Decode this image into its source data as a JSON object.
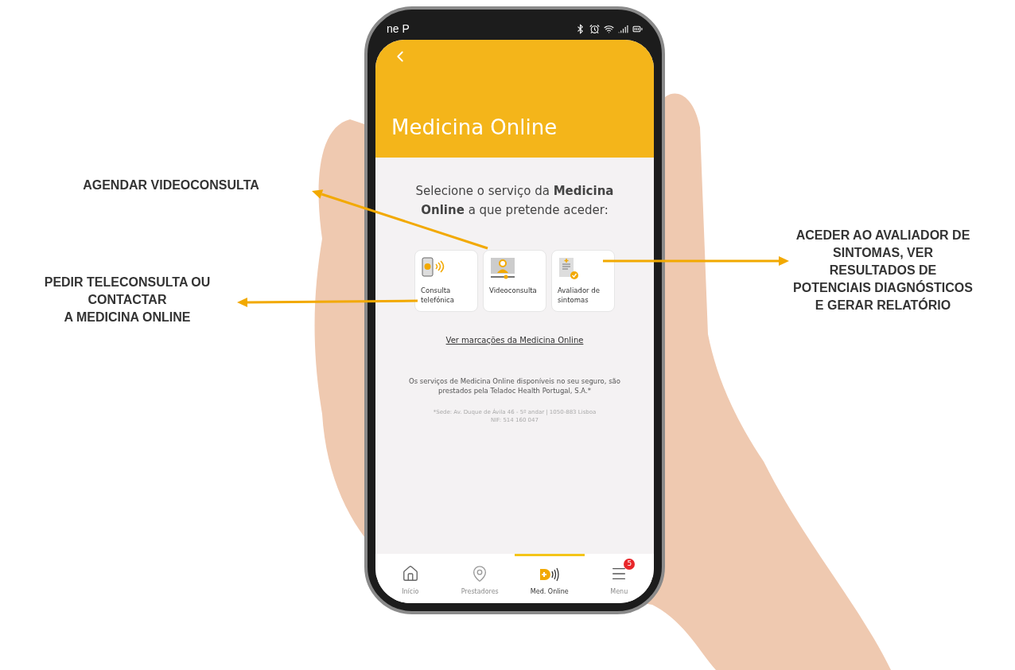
{
  "annotations": [
    {
      "text": "AGENDAR VIDEOCONSULTA"
    },
    {
      "text": "PEDIR TELECONSULTA OU\nCONTACTAR\nA MEDICINA ONLINE"
    },
    {
      "text": "ACEDER AO AVALIADOR DE\nSINTOMAS, VER\nRESULTADOS DE\nPOTENCIAIS DIAGNÓSTICOS\nE GERAR RELATÓRIO"
    }
  ],
  "phone": {
    "status_bar": {
      "carrier": "ne P"
    },
    "header": {
      "title": "Medicina Online"
    },
    "prompt": "Selecione o serviço da **Medicina Online** a que pretende aceder:",
    "services": [
      {
        "kind": "phone",
        "label": "Consulta telefónica"
      },
      {
        "kind": "video",
        "label": "Videoconsulta"
      },
      {
        "kind": "report",
        "label": "Avaliador de sintomas"
      }
    ],
    "link": "Ver marcações da Medicina Online",
    "note": "Os serviços de Medicina Online disponíveis no seu seguro, são prestados pela Teladoc Health Portugal, S.A.*",
    "address": "*Sede: Av. Duque de Ávila 46 - 5º andar | 1050-883 Lisboa\nNIF: 514 160 047",
    "tab_bar": [
      {
        "kind": "home",
        "label": "Início",
        "selected": false
      },
      {
        "kind": "pin",
        "label": "Prestadores",
        "selected": false
      },
      {
        "kind": "medonline",
        "label": "Med. Online",
        "selected": true
      },
      {
        "kind": "menu",
        "label": "Menu",
        "selected": false,
        "badge": "5"
      }
    ]
  }
}
